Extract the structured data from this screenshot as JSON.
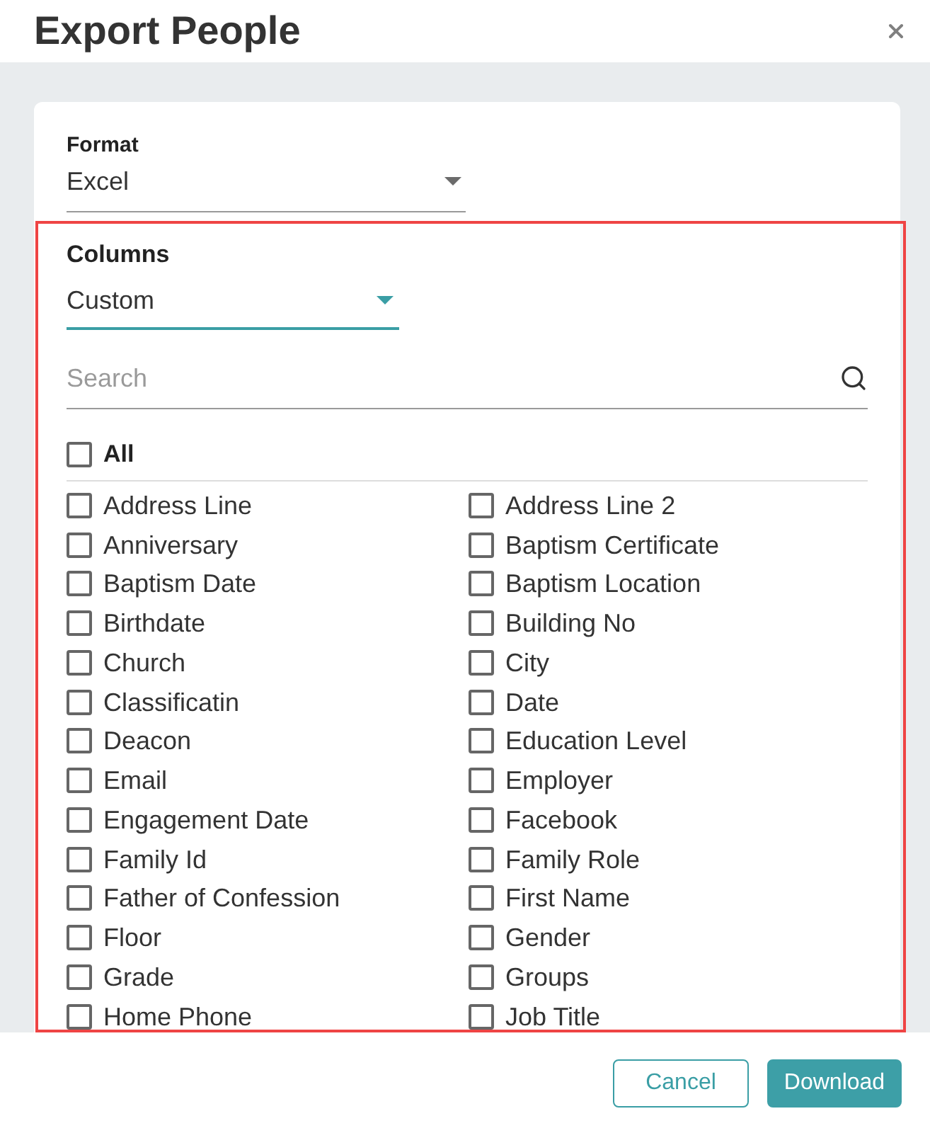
{
  "dialog": {
    "title": "Export People"
  },
  "format": {
    "label": "Format",
    "value": "Excel",
    "focused": false
  },
  "columns": {
    "highlighted": true,
    "label": "Columns",
    "value": "Custom",
    "focused": true,
    "search": {
      "placeholder": "Search"
    },
    "all": {
      "label": "All",
      "checked": false
    },
    "options": [
      {
        "label": "Address Line",
        "checked": false
      },
      {
        "label": "Address Line 2",
        "checked": false
      },
      {
        "label": "Anniversary",
        "checked": false
      },
      {
        "label": "Baptism Certificate",
        "checked": false
      },
      {
        "label": "Baptism Date",
        "checked": false
      },
      {
        "label": "Baptism Location",
        "checked": false
      },
      {
        "label": "Birthdate",
        "checked": false
      },
      {
        "label": "Building No",
        "checked": false
      },
      {
        "label": "Church",
        "checked": false
      },
      {
        "label": "City",
        "checked": false
      },
      {
        "label": "Classificatin",
        "checked": false
      },
      {
        "label": "Date",
        "checked": false
      },
      {
        "label": "Deacon",
        "checked": false
      },
      {
        "label": "Education Level",
        "checked": false
      },
      {
        "label": "Email",
        "checked": false
      },
      {
        "label": "Employer",
        "checked": false
      },
      {
        "label": "Engagement Date",
        "checked": false
      },
      {
        "label": "Facebook",
        "checked": false
      },
      {
        "label": "Family Id",
        "checked": false
      },
      {
        "label": "Family Role",
        "checked": false
      },
      {
        "label": "Father of Confession",
        "checked": false
      },
      {
        "label": "First Name",
        "checked": false
      },
      {
        "label": "Floor",
        "checked": false
      },
      {
        "label": "Gender",
        "checked": false
      },
      {
        "label": "Grade",
        "checked": false
      },
      {
        "label": "Groups",
        "checked": false
      },
      {
        "label": "Home Phone",
        "checked": false
      },
      {
        "label": "Job Title",
        "checked": false
      }
    ]
  },
  "buttons": [
    {
      "label": "Cancel",
      "kind": "outline"
    },
    {
      "label": "Download",
      "kind": "primary"
    }
  ]
}
